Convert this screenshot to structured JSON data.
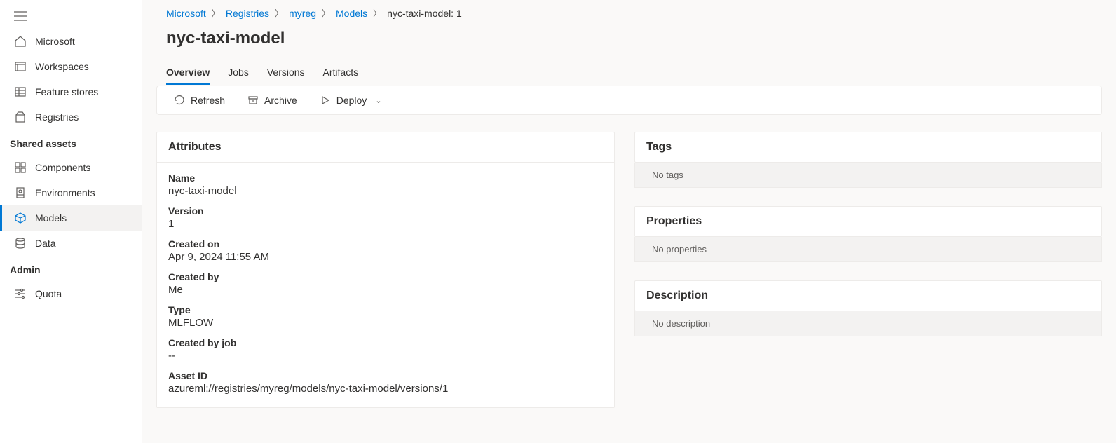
{
  "sidebar": {
    "items": [
      {
        "label": "Microsoft"
      },
      {
        "label": "Workspaces"
      },
      {
        "label": "Feature stores"
      },
      {
        "label": "Registries"
      }
    ],
    "shared_heading": "Shared assets",
    "shared": [
      {
        "label": "Components"
      },
      {
        "label": "Environments"
      },
      {
        "label": "Models"
      },
      {
        "label": "Data"
      }
    ],
    "admin_heading": "Admin",
    "admin": [
      {
        "label": "Quota"
      }
    ]
  },
  "breadcrumb": {
    "items": [
      "Microsoft",
      "Registries",
      "myreg",
      "Models"
    ],
    "current": "nyc-taxi-model: 1"
  },
  "page_title": "nyc-taxi-model",
  "tabs": [
    "Overview",
    "Jobs",
    "Versions",
    "Artifacts"
  ],
  "toolbar": {
    "refresh": "Refresh",
    "archive": "Archive",
    "deploy": "Deploy"
  },
  "attributes": {
    "heading": "Attributes",
    "items": [
      {
        "label": "Name",
        "value": "nyc-taxi-model"
      },
      {
        "label": "Version",
        "value": "1"
      },
      {
        "label": "Created on",
        "value": "Apr 9, 2024 11:55 AM"
      },
      {
        "label": "Created by",
        "value": "Me"
      },
      {
        "label": "Type",
        "value": "MLFLOW"
      },
      {
        "label": "Created by job",
        "value": "--"
      },
      {
        "label": "Asset ID",
        "value": "azureml://registries/myreg/models/nyc-taxi-model/versions/1"
      }
    ]
  },
  "tags": {
    "heading": "Tags",
    "empty": "No tags"
  },
  "properties": {
    "heading": "Properties",
    "empty": "No properties"
  },
  "description": {
    "heading": "Description",
    "empty": "No description"
  }
}
